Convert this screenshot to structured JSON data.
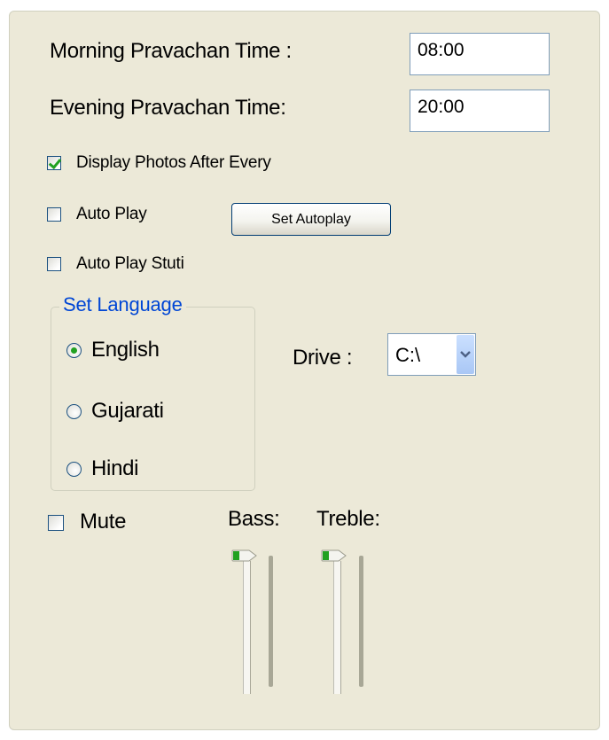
{
  "settings": {
    "morning_label": "Morning Pravachan Time :",
    "morning_value": "08:00",
    "evening_label": "Evening Pravachan Time:",
    "evening_value": "20:00",
    "display_photos_label": "Display Photos After Every",
    "display_photos_checked": true,
    "auto_play_label": "Auto Play",
    "auto_play_checked": false,
    "set_autoplay_label": "Set Autoplay",
    "auto_play_stuti_label": "Auto Play Stuti",
    "auto_play_stuti_checked": false
  },
  "language": {
    "group_title": "Set Language",
    "options": [
      {
        "label": "English",
        "selected": true
      },
      {
        "label": "Gujarati",
        "selected": false
      },
      {
        "label": "Hindi",
        "selected": false
      }
    ]
  },
  "drive": {
    "label": "Drive :",
    "selected": "C:\\"
  },
  "audio": {
    "mute_label": "Mute",
    "mute_checked": false,
    "bass_label": "Bass:",
    "treble_label": "Treble:",
    "bass_level": 1.0,
    "treble_level": 1.0
  },
  "colors": {
    "panel_bg": "#ece9d8",
    "accent_green": "#21a121",
    "group_title_blue": "#0046d5",
    "input_border": "#7f9db9"
  }
}
